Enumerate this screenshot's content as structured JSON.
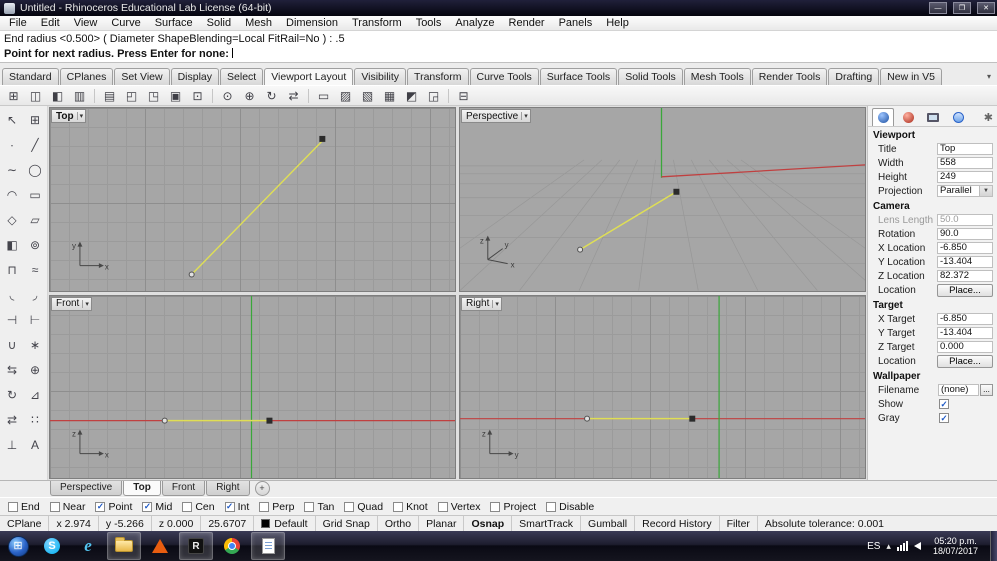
{
  "window": {
    "title": "Untitled - Rhinoceros Educational Lab License (64-bit)",
    "minimize_label": "—",
    "maximize_label": "❐",
    "close_label": "✕"
  },
  "menu": {
    "items": [
      "File",
      "Edit",
      "View",
      "Curve",
      "Surface",
      "Solid",
      "Mesh",
      "Dimension",
      "Transform",
      "Tools",
      "Analyze",
      "Render",
      "Panels",
      "Help"
    ]
  },
  "command": {
    "history": "End radius <0.500> ( Diameter  ShapeBlending=Local  FitRail=No ) : .5",
    "prompt": "Point for next radius. Press Enter for none:"
  },
  "ribbon": {
    "tabs": [
      "Standard",
      "CPlanes",
      "Set View",
      "Display",
      "Select",
      "Viewport Layout",
      "Visibility",
      "Transform",
      "Curve Tools",
      "Surface Tools",
      "Solid Tools",
      "Mesh Tools",
      "Render Tools",
      "Drafting",
      "New in V5"
    ],
    "active": "Viewport Layout",
    "overflow_glyph": "▾"
  },
  "toolbar": {
    "icons": [
      {
        "name": "viewport-layout-4-icon",
        "glyph": "⊞"
      },
      {
        "name": "viewport-layout-3-icon",
        "glyph": "◫"
      },
      {
        "name": "viewport-layout-2-icon",
        "glyph": "◧"
      },
      {
        "name": "viewport-columns-icon",
        "glyph": "▥"
      },
      {
        "name": "viewport-rows-icon",
        "glyph": "▤"
      },
      {
        "name": "viewport-corner-icon",
        "glyph": "◰"
      },
      {
        "name": "viewport-corner-2-icon",
        "glyph": "◳"
      },
      {
        "name": "maximize-viewport-icon",
        "glyph": "▣"
      },
      {
        "name": "single-viewport-icon",
        "glyph": "⊡"
      },
      {
        "name": "zoom-extents-icon",
        "glyph": "⊙"
      },
      {
        "name": "zoom-window-icon",
        "glyph": "⊕"
      },
      {
        "name": "rotate-view-icon",
        "glyph": "↻"
      },
      {
        "name": "pan-view-icon",
        "glyph": "⇄"
      },
      {
        "name": "named-view-icon",
        "glyph": "▭"
      },
      {
        "name": "shaded-view-icon",
        "glyph": "▨"
      },
      {
        "name": "wireframe-view-icon",
        "glyph": "▧"
      },
      {
        "name": "grid-toggle-icon",
        "glyph": "▦"
      },
      {
        "name": "background-toggle-icon",
        "glyph": "◩"
      },
      {
        "name": "viewport-properties-icon",
        "glyph": "◲"
      },
      {
        "name": "printer-icon",
        "glyph": "⊟"
      }
    ]
  },
  "left_toolbar": {
    "icons": [
      {
        "name": "select-icon",
        "glyph": "↖"
      },
      {
        "name": "selection-filter-icon",
        "glyph": "⊞"
      },
      {
        "name": "point-icon",
        "glyph": "∙"
      },
      {
        "name": "polyline-icon",
        "glyph": "╱"
      },
      {
        "name": "curve-icon",
        "glyph": "∼"
      },
      {
        "name": "circle-icon",
        "glyph": "◯"
      },
      {
        "name": "arc-icon",
        "glyph": "◠"
      },
      {
        "name": "rectangle-icon",
        "glyph": "▭"
      },
      {
        "name": "polygon-icon",
        "glyph": "◇"
      },
      {
        "name": "plane-icon",
        "glyph": "▱"
      },
      {
        "name": "surface-icon",
        "glyph": "◧"
      },
      {
        "name": "sphere-icon",
        "glyph": "⊚"
      },
      {
        "name": "extrude-icon",
        "glyph": "⊓"
      },
      {
        "name": "loft-icon",
        "glyph": "≈"
      },
      {
        "name": "fillet-icon",
        "glyph": "◟"
      },
      {
        "name": "chamfer-icon",
        "glyph": "◞"
      },
      {
        "name": "trim-icon",
        "glyph": "⊣"
      },
      {
        "name": "split-icon",
        "glyph": "⊢"
      },
      {
        "name": "join-icon",
        "glyph": "∪"
      },
      {
        "name": "explode-icon",
        "glyph": "∗"
      },
      {
        "name": "move-icon",
        "glyph": "⇆"
      },
      {
        "name": "copy-icon",
        "glyph": "⊕"
      },
      {
        "name": "rotate-icon",
        "glyph": "↻"
      },
      {
        "name": "scale-icon",
        "glyph": "⊿"
      },
      {
        "name": "mirror-icon",
        "glyph": "⇄"
      },
      {
        "name": "array-icon",
        "glyph": "∷"
      },
      {
        "name": "dimension-icon",
        "glyph": "⊥"
      },
      {
        "name": "text-icon",
        "glyph": "A"
      }
    ]
  },
  "viewports": {
    "top": "Top",
    "perspective": "Perspective",
    "front": "Front",
    "right": "Right",
    "menu_arrow": "▾"
  },
  "axis_labels": {
    "x": "x",
    "y": "y",
    "z": "z"
  },
  "colors": {
    "curve_yellow": "#dfdf55",
    "axis_red": "#c04040",
    "axis_green": "#3aa73a"
  },
  "panel": {
    "viewport": {
      "header": "Viewport",
      "title_label": "Title",
      "title_value": "Top",
      "width_label": "Width",
      "width_value": "558",
      "height_label": "Height",
      "height_value": "249",
      "projection_label": "Projection",
      "projection_value": "Parallel"
    },
    "camera": {
      "header": "Camera",
      "lens_label": "Lens Length",
      "lens_value": "50.0",
      "rotation_label": "Rotation",
      "rotation_value": "90.0",
      "x_label": "X Location",
      "x_value": "-6.850",
      "y_label": "Y Location",
      "y_value": "-13.404",
      "z_label": "Z Location",
      "z_value": "82.372",
      "location_label": "Location",
      "location_button": "Place..."
    },
    "target": {
      "header": "Target",
      "x_label": "X Target",
      "x_value": "-6.850",
      "y_label": "Y Target",
      "y_value": "-13.404",
      "z_label": "Z Target",
      "z_value": "0.000",
      "location_label": "Location",
      "location_button": "Place..."
    },
    "wallpaper": {
      "header": "Wallpaper",
      "filename_label": "Filename",
      "filename_value": "(none)",
      "browse_button": "...",
      "show_label": "Show",
      "show_checked": true,
      "gray_label": "Gray",
      "gray_checked": true
    }
  },
  "page_tabs": {
    "items": [
      "Perspective",
      "Top",
      "Front",
      "Right"
    ],
    "active": "Top",
    "add_label": "+"
  },
  "osnap": {
    "items": [
      {
        "label": "End",
        "checked": false
      },
      {
        "label": "Near",
        "checked": false
      },
      {
        "label": "Point",
        "checked": true
      },
      {
        "label": "Mid",
        "checked": true
      },
      {
        "label": "Cen",
        "checked": false
      },
      {
        "label": "Int",
        "checked": true
      },
      {
        "label": "Perp",
        "checked": false
      },
      {
        "label": "Tan",
        "checked": false
      },
      {
        "label": "Quad",
        "checked": false
      },
      {
        "label": "Knot",
        "checked": false
      },
      {
        "label": "Vertex",
        "checked": false
      },
      {
        "label": "Project",
        "checked": false
      },
      {
        "label": "Disable",
        "checked": false
      }
    ]
  },
  "status": {
    "cplane": "CPlane",
    "x": "x 2.974",
    "y": "y -5.266",
    "z": "z 0.000",
    "distance": "25.6707",
    "layer": "Default",
    "toggles": [
      "Grid Snap",
      "Ortho",
      "Planar",
      "Osnap",
      "SmartTrack",
      "Gumball",
      "Record History",
      "Filter"
    ],
    "active_toggle": "Osnap",
    "tolerance": "Absolute tolerance: 0.001"
  },
  "taskbar": {
    "language": "ES",
    "hidden_icons_glyph": "▴",
    "time": "05:20 p.m.",
    "date": "18/07/2017"
  }
}
